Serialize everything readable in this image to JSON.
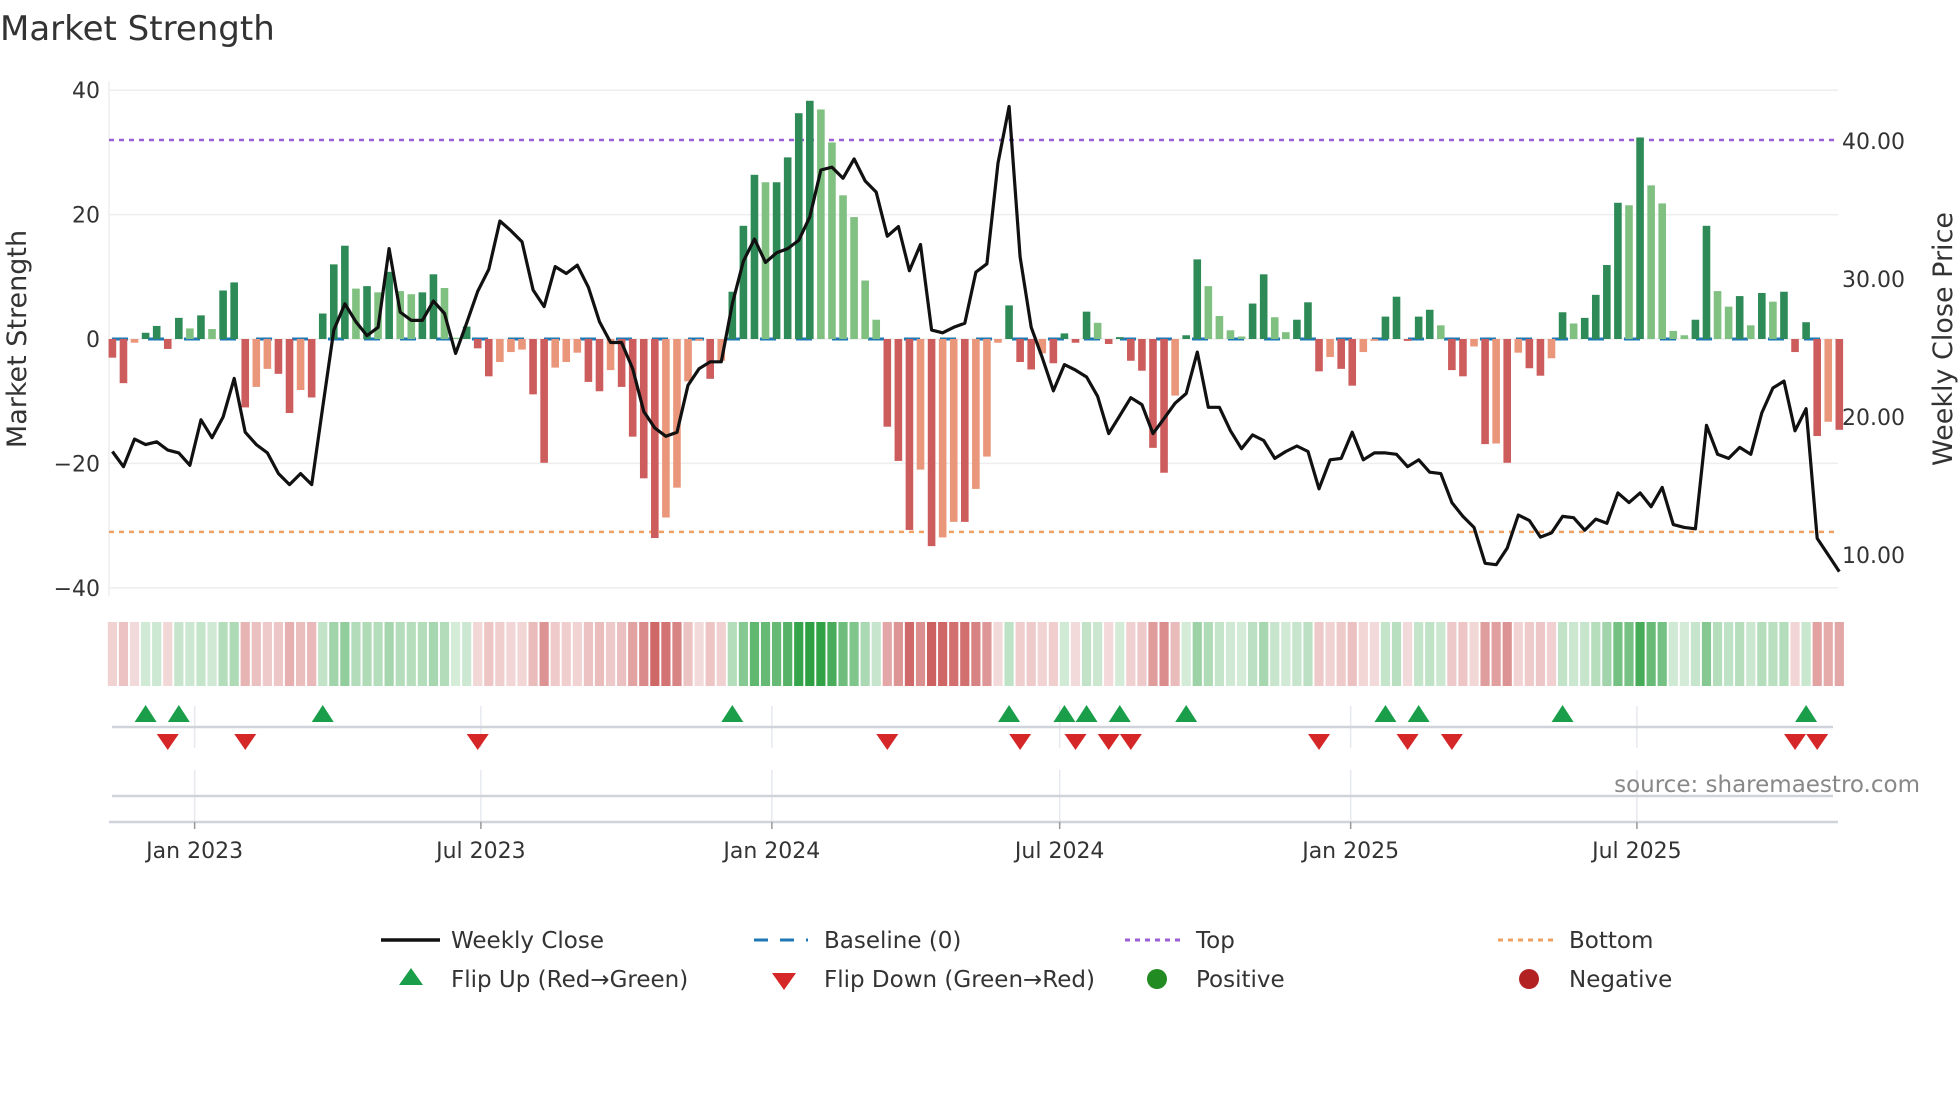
{
  "title": "Market Strength",
  "source": "source: sharemaestro.com",
  "colors": {
    "pos_strong": "#2e8b57",
    "pos_weak": "#80c080",
    "neg_strong": "#cd5c5c",
    "neg_weak": "#e9967a",
    "line": "#111111",
    "baseline": "#1f77b4",
    "top": "#9b5fd6",
    "bottom": "#f0a060",
    "flip_up": "#1a9e4a",
    "flip_down": "#d62728",
    "positive": "#228b22",
    "negative": "#b22222",
    "strip_pos": "46,160,67",
    "strip_neg": "200,80,80"
  },
  "chart_data": {
    "type": "bar+line",
    "title": "Market Strength",
    "ylabel": "Market Strength",
    "y2label": "Weekly Close Price",
    "ylim": [
      -42,
      42
    ],
    "y2lim": [
      7,
      46
    ],
    "yticks": [
      {
        "v": 40,
        "label": "40"
      },
      {
        "v": 20,
        "label": "20"
      },
      {
        "v": 0,
        "label": "0"
      },
      {
        "v": -20,
        "label": "−20"
      },
      {
        "v": -40,
        "label": "−40"
      }
    ],
    "y2ticks": [
      {
        "v": 40,
        "label": "40.00"
      },
      {
        "v": 30,
        "label": "30.00"
      },
      {
        "v": 20,
        "label": "20.00"
      },
      {
        "v": 10,
        "label": "10.00"
      }
    ],
    "first_week": "2022-11-10",
    "xticks": [
      {
        "label": "Jan 2023",
        "date": "2023-01-01"
      },
      {
        "label": "Jul 2023",
        "date": "2023-07-01"
      },
      {
        "label": "Jan 2024",
        "date": "2024-01-01"
      },
      {
        "label": "Jul 2024",
        "date": "2024-07-01"
      },
      {
        "label": "Jan 2025",
        "date": "2025-01-01"
      },
      {
        "label": "Jul 2025",
        "date": "2025-07-01"
      }
    ],
    "top_level": 32,
    "bottom_level": -31,
    "baseline": 0,
    "strength": [
      -3.0,
      -7.1,
      -0.6,
      1.0,
      2.1,
      -1.6,
      3.4,
      1.7,
      3.8,
      1.6,
      7.8,
      9.1,
      -11.0,
      -7.7,
      -4.8,
      -5.6,
      -11.9,
      -8.2,
      -9.4,
      4.1,
      12.0,
      15.0,
      8.1,
      8.5,
      7.5,
      10.8,
      7.7,
      7.2,
      7.5,
      10.4,
      8.2,
      0.2,
      2.0,
      -1.5,
      -6.0,
      -3.7,
      -2.1,
      -1.7,
      -8.9,
      -19.9,
      -4.6,
      -3.7,
      -2.2,
      -6.9,
      -8.4,
      -5.0,
      -7.7,
      -15.7,
      -22.4,
      -32.0,
      -28.7,
      -23.9,
      -6.8,
      -0.3,
      -6.4,
      -3.5,
      7.6,
      18.2,
      26.4,
      25.2,
      25.2,
      29.2,
      36.3,
      38.3,
      36.9,
      31.6,
      23.1,
      19.6,
      9.4,
      3.1,
      -14.1,
      -19.6,
      -30.7,
      -21.0,
      -33.3,
      -31.9,
      -29.4,
      -29.4,
      -24.1,
      -18.9,
      -0.6,
      5.4,
      -3.7,
      -4.9,
      -2.3,
      -3.9,
      0.9,
      -0.6,
      4.4,
      2.6,
      -0.8,
      0.3,
      -3.5,
      -5.1,
      -17.5,
      -21.5,
      -9.1,
      0.6,
      12.8,
      8.5,
      3.7,
      1.4,
      0.4,
      5.7,
      10.4,
      3.5,
      1.1,
      3.1,
      5.9,
      -5.2,
      -2.9,
      -4.8,
      -7.5,
      -2.1,
      -0.3,
      3.6,
      6.8,
      -0.3,
      3.6,
      4.7,
      2.2,
      -5.0,
      -6.0,
      -1.2,
      -16.9,
      -16.8,
      -19.9,
      -2.2,
      -4.7,
      -5.9,
      -3.1,
      4.3,
      2.5,
      3.4,
      7.1,
      11.9,
      21.9,
      21.5,
      32.4,
      24.7,
      21.8,
      1.3,
      0.6,
      3.1,
      18.2,
      7.7,
      5.2,
      6.9,
      2.2,
      7.4,
      6.0,
      7.6,
      -2.1,
      2.7,
      -15.6,
      -13.3,
      -14.6
    ],
    "weekly_close": [
      17.5,
      16.4,
      18.4,
      18.0,
      18.2,
      17.6,
      17.4,
      16.5,
      19.8,
      18.5,
      20.0,
      22.8,
      18.9,
      18.0,
      17.4,
      15.9,
      15.1,
      15.9,
      15.1,
      20.7,
      26.3,
      28.2,
      26.9,
      25.9,
      26.5,
      32.2,
      27.6,
      27.0,
      27.0,
      28.4,
      27.5,
      24.6,
      26.8,
      29.1,
      30.7,
      34.2,
      33.5,
      32.7,
      29.2,
      28.0,
      30.9,
      30.4,
      31.0,
      29.4,
      26.9,
      25.4,
      25.4,
      23.5,
      20.4,
      19.2,
      18.6,
      18.9,
      22.3,
      23.5,
      24.0,
      24.0,
      28.2,
      31.3,
      32.9,
      31.2,
      31.9,
      32.2,
      32.8,
      34.5,
      37.9,
      38.1,
      37.3,
      38.7,
      37.1,
      36.3,
      33.1,
      33.8,
      30.6,
      32.5,
      26.3,
      26.1,
      26.5,
      26.8,
      30.5,
      31.1,
      38.4,
      42.5,
      31.6,
      26.5,
      24.3,
      21.9,
      23.8,
      23.4,
      22.9,
      21.5,
      18.8,
      20.1,
      21.4,
      20.9,
      18.8,
      19.9,
      21.0,
      21.7,
      24.7,
      20.7,
      20.7,
      19.0,
      17.7,
      18.7,
      18.3,
      17.0,
      17.5,
      17.9,
      17.5,
      14.8,
      16.9,
      17.0,
      18.9,
      16.9,
      17.4,
      17.4,
      17.3,
      16.4,
      16.9,
      16.0,
      15.9,
      13.8,
      12.8,
      12.0,
      9.4,
      9.3,
      10.5,
      12.9,
      12.5,
      11.3,
      11.6,
      12.8,
      12.7,
      11.8,
      12.6,
      12.3,
      14.5,
      13.8,
      14.5,
      13.5,
      14.9,
      12.2,
      12.0,
      11.9,
      19.4,
      17.3,
      17.0,
      17.8,
      17.3,
      20.3,
      22.1,
      22.6,
      19.0,
      20.6,
      11.2,
      10.0,
      8.8
    ],
    "legend": [
      {
        "key": "close",
        "label": "Weekly Close"
      },
      {
        "key": "baseline",
        "label": "Baseline (0)"
      },
      {
        "key": "top",
        "label": "Top"
      },
      {
        "key": "bottom",
        "label": "Bottom"
      },
      {
        "key": "flip_up",
        "label": "Flip Up (Red→Green)"
      },
      {
        "key": "flip_down",
        "label": "Flip Down (Green→Red)"
      },
      {
        "key": "positive",
        "label": "Positive"
      },
      {
        "key": "negative",
        "label": "Negative"
      }
    ],
    "legend_placement": "bottom"
  }
}
